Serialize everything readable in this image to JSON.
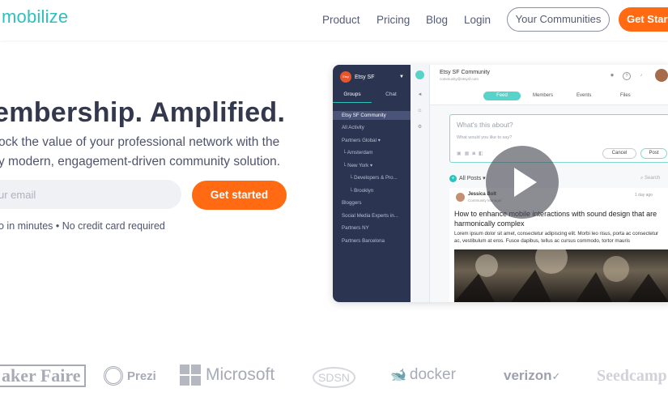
{
  "brand": {
    "logo_text": "mobilize",
    "accent": "#2cc1bd",
    "cta_color": "#ff6a13"
  },
  "nav": {
    "links": [
      "Product",
      "Pricing",
      "Blog",
      "Login"
    ],
    "communities_button": "Your Communities",
    "cta_button": "Get Start"
  },
  "hero": {
    "title": "embership. Amplified.",
    "subtitle_line1": "ock the value of your professional network with the",
    "subtitle_line2": "y modern, engagement-driven community solution.",
    "email_placeholder": "ur email",
    "cta": "Get started",
    "note": "o in minutes • No credit card required"
  },
  "preview": {
    "workspace_name": "Etsy SF",
    "workspace_badge": "Etsy",
    "sidebar_tabs": [
      "Groups",
      "Chat"
    ],
    "sidebar_items": [
      {
        "label": "Etsy SF Community",
        "selected": true
      },
      {
        "label": "All Activity"
      },
      {
        "label": "Partners Global ▾"
      },
      {
        "label": "└ Amsterdam"
      },
      {
        "label": "└ New York ▾"
      },
      {
        "label": "└ Developers & Pro..."
      },
      {
        "label": "└ Brooklyn"
      },
      {
        "label": "Bloggers"
      },
      {
        "label": "Social Media Experts in..."
      },
      {
        "label": "Partners NY"
      },
      {
        "label": "Partners Barcelona"
      }
    ],
    "community_title": "Etsy SF Community",
    "community_email": "community@etsysf.com",
    "tabs": [
      "Feed",
      "Members",
      "Events",
      "Files"
    ],
    "compose_question": "What's this about?",
    "compose_prompt": "What would you like to say?",
    "cancel": "Cancel",
    "post": "Post",
    "all_posts": "All Posts ▾",
    "search": "Search",
    "card": {
      "author": "Jessica Bolt",
      "role": "Community Manager",
      "time": "1 day ago",
      "title": "How to enhance mobile interactions with sound design that are harmonically complex",
      "body": "Lorem ipsum dolor sit amet, consectetur adipiscing elit. Morbi leo risus, porta ac consectetur ac, vestibulum at eros. Fusce dapibus, tellus ac cursus commodo, tortor mauris"
    }
  },
  "logos": [
    "aker Faire",
    "Prezi",
    "Microsoft",
    "SDSN",
    "docker",
    "verizon",
    "Seedcamp"
  ]
}
